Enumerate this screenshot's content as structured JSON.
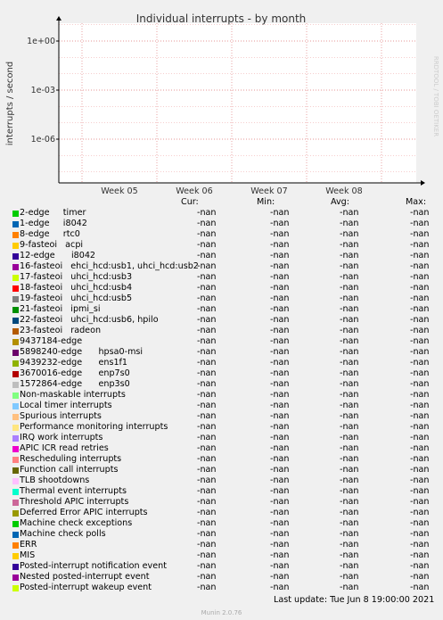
{
  "title": "Individual interrupts - by month",
  "ylabel": "interrupts / second",
  "watermark": "RRDTOOL / TOBI OETIKER",
  "chart_data": {
    "type": "line",
    "title": "Individual interrupts - by month",
    "ylabel": "interrupts / second",
    "yscale": "log",
    "ylim": [
      1e-08,
      10
    ],
    "yticks": [
      "1e+00",
      "1e-03",
      "1e-06"
    ],
    "xticks": [
      "Week 05",
      "Week 06",
      "Week 07",
      "Week 08"
    ],
    "grid": true,
    "series": []
  },
  "legend_headers": {
    "cur": "Cur:",
    "min": "Min:",
    "avg": "Avg:",
    "max": "Max:"
  },
  "rows": [
    {
      "label": "2-edge     timer",
      "color": "#00cc00",
      "cur": "-nan",
      "min": "-nan",
      "avg": "-nan",
      "max": "-nan"
    },
    {
      "label": "1-edge     i8042",
      "color": "#0066b3",
      "cur": "-nan",
      "min": "-nan",
      "avg": "-nan",
      "max": "-nan"
    },
    {
      "label": "8-edge     rtc0",
      "color": "#ff8000",
      "cur": "-nan",
      "min": "-nan",
      "avg": "-nan",
      "max": "-nan"
    },
    {
      "label": "9-fasteoi   acpi",
      "color": "#ffcc00",
      "cur": "-nan",
      "min": "-nan",
      "avg": "-nan",
      "max": "-nan"
    },
    {
      "label": "12-edge      i8042",
      "color": "#330099",
      "cur": "-nan",
      "min": "-nan",
      "avg": "-nan",
      "max": "-nan"
    },
    {
      "label": "16-fasteoi   ehci_hcd:usb1, uhci_hcd:usb2",
      "color": "#990099",
      "cur": "-nan",
      "min": "-nan",
      "avg": "-nan",
      "max": "-nan"
    },
    {
      "label": "17-fasteoi   uhci_hcd:usb3",
      "color": "#ccff00",
      "cur": "-nan",
      "min": "-nan",
      "avg": "-nan",
      "max": "-nan"
    },
    {
      "label": "18-fasteoi   uhci_hcd:usb4",
      "color": "#ff0000",
      "cur": "-nan",
      "min": "-nan",
      "avg": "-nan",
      "max": "-nan"
    },
    {
      "label": "19-fasteoi   uhci_hcd:usb5",
      "color": "#808080",
      "cur": "-nan",
      "min": "-nan",
      "avg": "-nan",
      "max": "-nan"
    },
    {
      "label": "21-fasteoi   ipmi_si",
      "color": "#008f00",
      "cur": "-nan",
      "min": "-nan",
      "avg": "-nan",
      "max": "-nan"
    },
    {
      "label": "22-fasteoi   uhci_hcd:usb6, hpilo",
      "color": "#00487d",
      "cur": "-nan",
      "min": "-nan",
      "avg": "-nan",
      "max": "-nan"
    },
    {
      "label": "23-fasteoi   radeon",
      "color": "#b35a00",
      "cur": "-nan",
      "min": "-nan",
      "avg": "-nan",
      "max": "-nan"
    },
    {
      "label": "9437184-edge",
      "color": "#b38f00",
      "cur": "-nan",
      "min": "-nan",
      "avg": "-nan",
      "max": "-nan"
    },
    {
      "label": "5898240-edge      hpsa0-msi",
      "color": "#6b006b",
      "cur": "-nan",
      "min": "-nan",
      "avg": "-nan",
      "max": "-nan"
    },
    {
      "label": "9439232-edge      ens1f1",
      "color": "#8fb300",
      "cur": "-nan",
      "min": "-nan",
      "avg": "-nan",
      "max": "-nan"
    },
    {
      "label": "3670016-edge      enp7s0",
      "color": "#b30000",
      "cur": "-nan",
      "min": "-nan",
      "avg": "-nan",
      "max": "-nan"
    },
    {
      "label": "1572864-edge      enp3s0",
      "color": "#bebebe",
      "cur": "-nan",
      "min": "-nan",
      "avg": "-nan",
      "max": "-nan"
    },
    {
      "label": "Non-maskable interrupts",
      "color": "#80ff80",
      "cur": "-nan",
      "min": "-nan",
      "avg": "-nan",
      "max": "-nan"
    },
    {
      "label": "Local timer interrupts",
      "color": "#80c9ff",
      "cur": "-nan",
      "min": "-nan",
      "avg": "-nan",
      "max": "-nan"
    },
    {
      "label": "Spurious interrupts",
      "color": "#ffc080",
      "cur": "-nan",
      "min": "-nan",
      "avg": "-nan",
      "max": "-nan"
    },
    {
      "label": "Performance monitoring interrupts",
      "color": "#ffe680",
      "cur": "-nan",
      "min": "-nan",
      "avg": "-nan",
      "max": "-nan"
    },
    {
      "label": "IRQ work interrupts",
      "color": "#aa80ff",
      "cur": "-nan",
      "min": "-nan",
      "avg": "-nan",
      "max": "-nan"
    },
    {
      "label": "APIC ICR read retries",
      "color": "#ee00cc",
      "cur": "-nan",
      "min": "-nan",
      "avg": "-nan",
      "max": "-nan"
    },
    {
      "label": "Rescheduling interrupts",
      "color": "#ff8080",
      "cur": "-nan",
      "min": "-nan",
      "avg": "-nan",
      "max": "-nan"
    },
    {
      "label": "Function call interrupts",
      "color": "#666600",
      "cur": "-nan",
      "min": "-nan",
      "avg": "-nan",
      "max": "-nan"
    },
    {
      "label": "TLB shootdowns",
      "color": "#ffbfff",
      "cur": "-nan",
      "min": "-nan",
      "avg": "-nan",
      "max": "-nan"
    },
    {
      "label": "Thermal event interrupts",
      "color": "#00ffcc",
      "cur": "-nan",
      "min": "-nan",
      "avg": "-nan",
      "max": "-nan"
    },
    {
      "label": "Threshold APIC interrupts",
      "color": "#cc6699",
      "cur": "-nan",
      "min": "-nan",
      "avg": "-nan",
      "max": "-nan"
    },
    {
      "label": "Deferred Error APIC interrupts",
      "color": "#999900",
      "cur": "-nan",
      "min": "-nan",
      "avg": "-nan",
      "max": "-nan"
    },
    {
      "label": "Machine check exceptions",
      "color": "#00cc00",
      "cur": "-nan",
      "min": "-nan",
      "avg": "-nan",
      "max": "-nan"
    },
    {
      "label": "Machine check polls",
      "color": "#0066b3",
      "cur": "-nan",
      "min": "-nan",
      "avg": "-nan",
      "max": "-nan"
    },
    {
      "label": "ERR",
      "color": "#ff8000",
      "cur": "-nan",
      "min": "-nan",
      "avg": "-nan",
      "max": "-nan"
    },
    {
      "label": "MIS",
      "color": "#ffcc00",
      "cur": "-nan",
      "min": "-nan",
      "avg": "-nan",
      "max": "-nan"
    },
    {
      "label": "Posted-interrupt notification event",
      "color": "#330099",
      "cur": "-nan",
      "min": "-nan",
      "avg": "-nan",
      "max": "-nan"
    },
    {
      "label": "Nested posted-interrupt event",
      "color": "#990099",
      "cur": "-nan",
      "min": "-nan",
      "avg": "-nan",
      "max": "-nan"
    },
    {
      "label": "Posted-interrupt wakeup event",
      "color": "#ccff00",
      "cur": "-nan",
      "min": "-nan",
      "avg": "-nan",
      "max": "-nan"
    }
  ],
  "last_update": "Last update: Tue Jun  8 19:00:00 2021",
  "footer": "Munin 2.0.76"
}
